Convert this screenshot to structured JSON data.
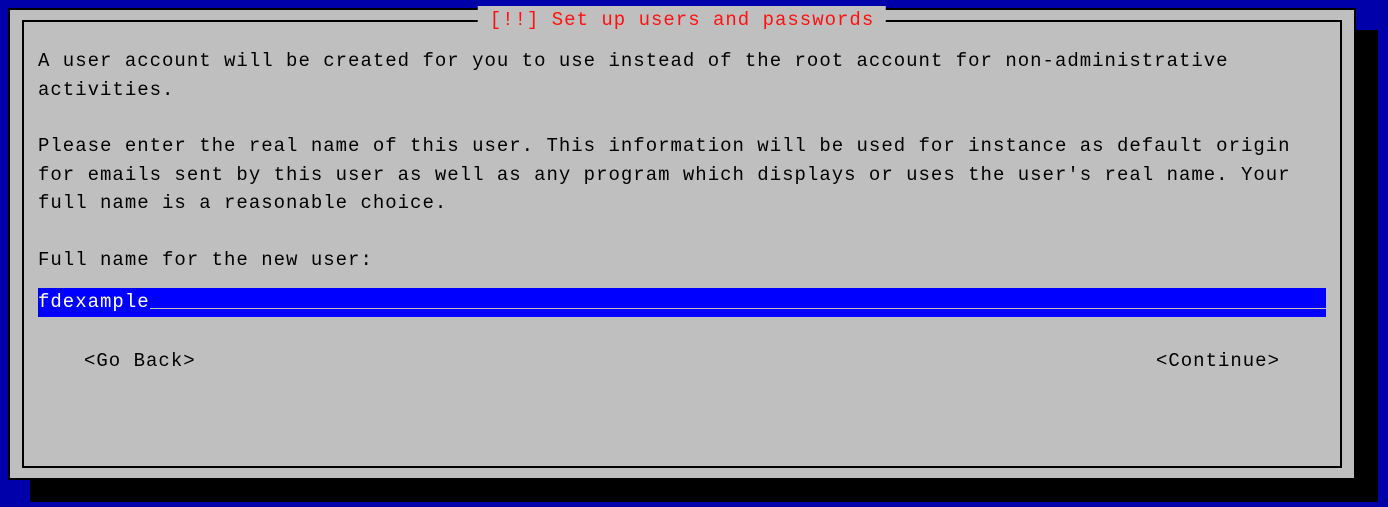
{
  "dialog": {
    "title": "[!!] Set up users and passwords",
    "paragraph1": "A user account will be created for you to use instead of the root account for non-administrative activities.",
    "paragraph2": "Please enter the real name of this user. This information will be used for instance as default origin for emails sent by this user as well as any program which displays or uses the user's real name. Your full name is a reasonable choice.",
    "prompt": "Full name for the new user:",
    "input_value": "fdexample",
    "buttons": {
      "back": "<Go Back>",
      "continue": "<Continue>"
    }
  }
}
